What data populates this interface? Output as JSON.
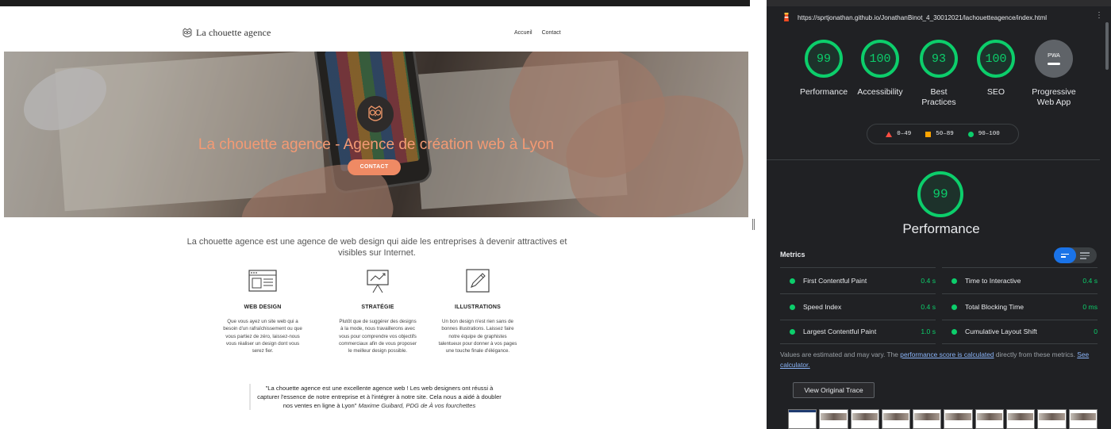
{
  "website": {
    "logo_text": "La chouette agence",
    "nav": {
      "home": "Accueil",
      "contact": "Contact"
    },
    "hero": {
      "title": "La chouette agence - Agence de création web à Lyon",
      "button": "CONTACT"
    },
    "intro": "La chouette agence est une agence de web design qui aide les entreprises à devenir attractives et visibles sur Internet.",
    "services": [
      {
        "icon": "web-design-icon",
        "title": "WEB DESIGN",
        "description": "Que vous ayez un site web qui a besoin d'un rafraîchissement ou que vous partiez de zéro, laissez-nous vous réaliser un design dont vous serez fier."
      },
      {
        "icon": "strategy-icon",
        "title": "STRATÉGIE",
        "description": "Plutôt que de suggérer des designs à la mode, nous travaillerons avec vous pour comprendre vos objectifs commerciaux afin de vous proposer le meilleur design possible."
      },
      {
        "icon": "illustration-icon",
        "title": "ILLUSTRATIONS",
        "description": "Un bon design n'est rien sans de bonnes illustrations. Laissez faire notre équipe de graphistes talentueux pour donner à vos pages une touche finale d'élégance."
      }
    ],
    "testimonial": {
      "quote": "\"La chouette agence est une excellente agence web ! Les web designers ont réussi à capturer l'essence de notre entreprise et à l'intégrer à notre site. Cela nous a aidé à doubler nos ventes en ligne à Lyon\"",
      "author": "Maxime Guibard, PDG de À vos fourchettes"
    }
  },
  "lighthouse": {
    "url": "https://sprtjonathan.github.io/JonathanBinot_4_30012021/lachouetteagence/index.html",
    "menu_icon": "more-vertical-icon",
    "scores": [
      {
        "value": "99",
        "label": "Performance"
      },
      {
        "value": "100",
        "label": "Accessibility"
      },
      {
        "value": "93",
        "label": "Best Practices"
      },
      {
        "value": "100",
        "label": "SEO"
      }
    ],
    "pwa": {
      "badge": "PWA",
      "label": "Progressive Web App"
    },
    "legend": [
      {
        "range": "0–49",
        "color": "#ff4e42"
      },
      {
        "range": "50–89",
        "color": "#ffa400"
      },
      {
        "range": "90–100",
        "color": "#0cce6b"
      }
    ],
    "performance": {
      "score": "99",
      "title": "Performance"
    },
    "metrics_title": "Metrics",
    "metrics": [
      {
        "name": "First Contentful Paint",
        "value": "0.4 s"
      },
      {
        "name": "Time to Interactive",
        "value": "0.4 s"
      },
      {
        "name": "Speed Index",
        "value": "0.4 s"
      },
      {
        "name": "Total Blocking Time",
        "value": "0 ms"
      },
      {
        "name": "Largest Contentful Paint",
        "value": "1.0 s"
      },
      {
        "name": "Cumulative Layout Shift",
        "value": "0"
      }
    ],
    "note": {
      "prefix": "Values are estimated and may vary. The ",
      "link1": "performance score is calculated",
      "middle": " directly from these metrics. ",
      "link2": "See calculator."
    },
    "trace_button": "View Original Trace",
    "colors": {
      "pass": "#0cce6b",
      "accent": "#1a73e8",
      "background": "#202124"
    }
  }
}
